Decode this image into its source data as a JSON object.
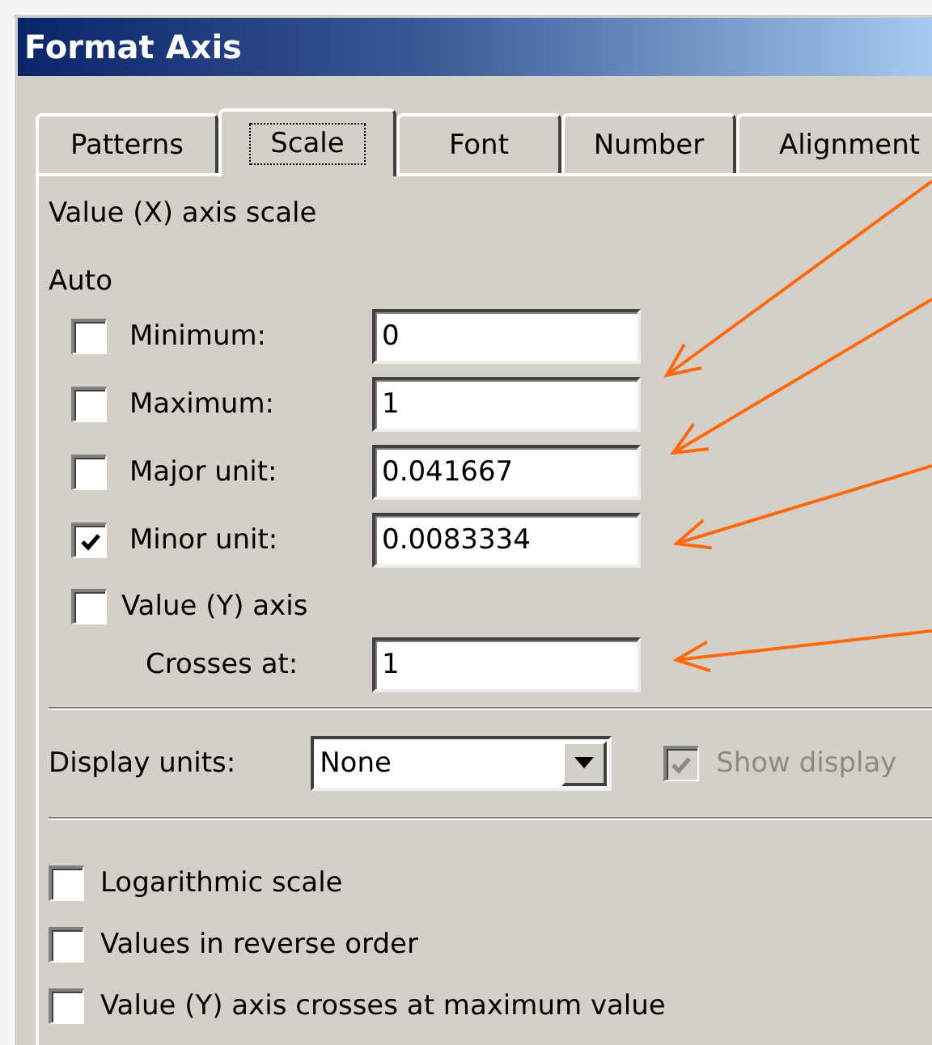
{
  "window": {
    "title": "Format Axis"
  },
  "tabs": [
    {
      "label": "Patterns",
      "selected": false
    },
    {
      "label": "Scale",
      "selected": true
    },
    {
      "label": "Font",
      "selected": false
    },
    {
      "label": "Number",
      "selected": false
    },
    {
      "label": "Alignment",
      "selected": false
    }
  ],
  "scale": {
    "heading": "Value (X) axis scale",
    "auto_label": "Auto",
    "rows": [
      {
        "kind": "check_field",
        "label": "Minimum:",
        "checked": false,
        "value": "0"
      },
      {
        "kind": "check_field",
        "label": "Maximum:",
        "checked": false,
        "value": "1"
      },
      {
        "kind": "check_field",
        "label": "Major unit:",
        "checked": false,
        "value": "0.041667"
      },
      {
        "kind": "check_field",
        "label": "Minor unit:",
        "checked": true,
        "value": "0.0083334"
      },
      {
        "kind": "check",
        "label": "Value (Y) axis",
        "checked": false
      },
      {
        "kind": "field",
        "label": "Crosses at:",
        "value": "1"
      }
    ],
    "display_units": {
      "label": "Display units:",
      "value": "None"
    },
    "show_display": {
      "label": "Show display",
      "checked": true,
      "disabled": true
    },
    "options": [
      {
        "label": "Logarithmic scale",
        "checked": false
      },
      {
        "label": "Values in reverse order",
        "checked": false
      },
      {
        "label": "Value (Y) axis crosses at maximum value",
        "checked": false
      }
    ]
  }
}
